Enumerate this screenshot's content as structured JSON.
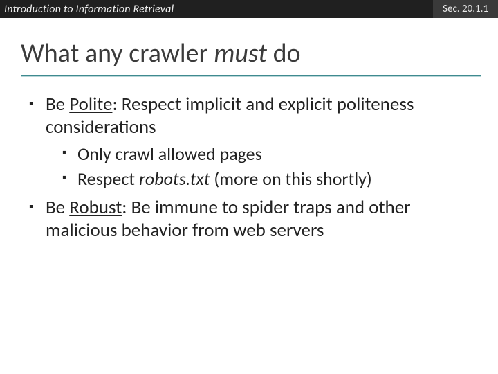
{
  "header": {
    "course": "Introduction to Information Retrieval",
    "section": "Sec. 20.1.1"
  },
  "title": {
    "pre": "What any crawler ",
    "em": "must",
    "post": " do"
  },
  "bullets": {
    "b1": {
      "pre": "Be ",
      "key": "Polite",
      "rest": ": Respect implicit and explicit politeness considerations",
      "sub1": "Only crawl allowed pages",
      "sub2_pre": "Respect ",
      "sub2_em": "robots.txt",
      "sub2_post": " (more on this shortly)"
    },
    "b2": {
      "pre": "Be ",
      "key": "Robust",
      "rest": ": Be immune to spider traps and other malicious behavior from web servers"
    }
  }
}
